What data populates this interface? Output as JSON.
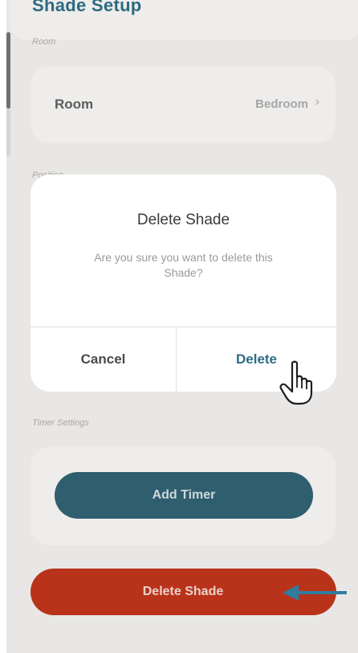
{
  "header": {
    "title": "Shade Setup"
  },
  "room_section": {
    "label": "Room",
    "row_label": "Room",
    "row_value": "Bedroom",
    "chevron": "›"
  },
  "hidden_section": {
    "label": "Position"
  },
  "dialog": {
    "title": "Delete Shade",
    "message": "Are you sure you want to delete this Shade?",
    "cancel_label": "Cancel",
    "delete_label": "Delete"
  },
  "timer_section": {
    "label": "Timer Settings",
    "add_timer_label": "Add Timer"
  },
  "footer": {
    "delete_shade_label": "Delete Shade"
  },
  "colors": {
    "accent": "#2f6a82",
    "danger": "#b9331b",
    "annotation_arrow": "#2f7c9f"
  },
  "icons": {
    "cursor": "hand-pointer-icon",
    "arrow": "arrow-left-icon"
  }
}
